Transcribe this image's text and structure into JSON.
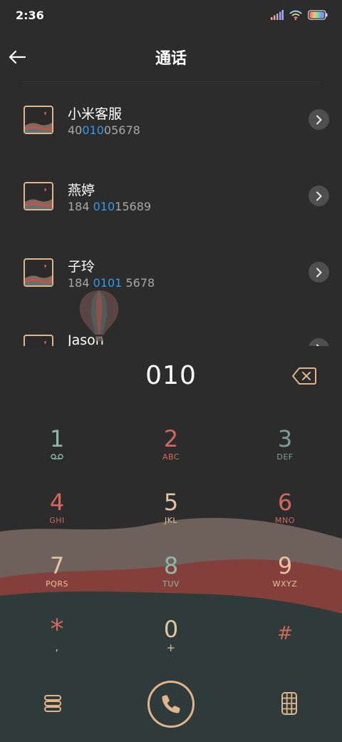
{
  "status_bar": {
    "time": "2:36"
  },
  "header": {
    "title": "通话"
  },
  "contacts": [
    {
      "name": "小米客服",
      "number_pre": "40",
      "number_match": "010",
      "number_post": "05678"
    },
    {
      "name": "燕婷",
      "number_pre": "184 ",
      "number_match": "010",
      "number_post": "15689"
    },
    {
      "name": "子玲",
      "number_pre": "184 ",
      "number_match": "0101",
      "number_post": " 5678"
    },
    {
      "name": "Jason",
      "number_pre": "",
      "number_match": "",
      "number_post": ""
    }
  ],
  "dialer": {
    "input": "010"
  },
  "keypad": [
    {
      "digit": "1",
      "letters": "",
      "digit_color": "#8fb8a8",
      "letters_color": "#8fb8a8",
      "icon": "voicemail-icon"
    },
    {
      "digit": "2",
      "letters": "ABC",
      "digit_color": "#d3685b",
      "letters_color": "#d3685b"
    },
    {
      "digit": "3",
      "letters": "DEF",
      "digit_color": "#7aa198",
      "letters_color": "#7aa198"
    },
    {
      "digit": "4",
      "letters": "GHI",
      "digit_color": "#d3685b",
      "letters_color": "#d3685b"
    },
    {
      "digit": "5",
      "letters": "JKL",
      "digit_color": "#e4c39f",
      "letters_color": "#e4c39f"
    },
    {
      "digit": "6",
      "letters": "MNO",
      "digit_color": "#d3685b",
      "letters_color": "#d3685b"
    },
    {
      "digit": "7",
      "letters": "PQRS",
      "digit_color": "#e4c39f",
      "letters_color": "#e4c39f"
    },
    {
      "digit": "8",
      "letters": "TUV",
      "digit_color": "#8fb8a8",
      "letters_color": "#8fb8a8"
    },
    {
      "digit": "9",
      "letters": "WXYZ",
      "digit_color": "#e4c39f",
      "letters_color": "#e4c39f"
    },
    {
      "digit": "*",
      "letters": ",",
      "digit_color": "#d3685b",
      "letters_color": "#e4c39f"
    },
    {
      "digit": "0",
      "letters": "+",
      "digit_color": "#e4c39f",
      "letters_color": "#e4c39f"
    },
    {
      "digit": "#",
      "letters": "",
      "digit_color": "#d3685b",
      "letters_color": "#d3685b"
    }
  ],
  "colors": {
    "background": "#2c2c2c",
    "match_highlight": "#2f9bea",
    "accent_tan": "#e0b58c",
    "accent_red": "#d3685b",
    "accent_teal": "#8fb8a8"
  }
}
